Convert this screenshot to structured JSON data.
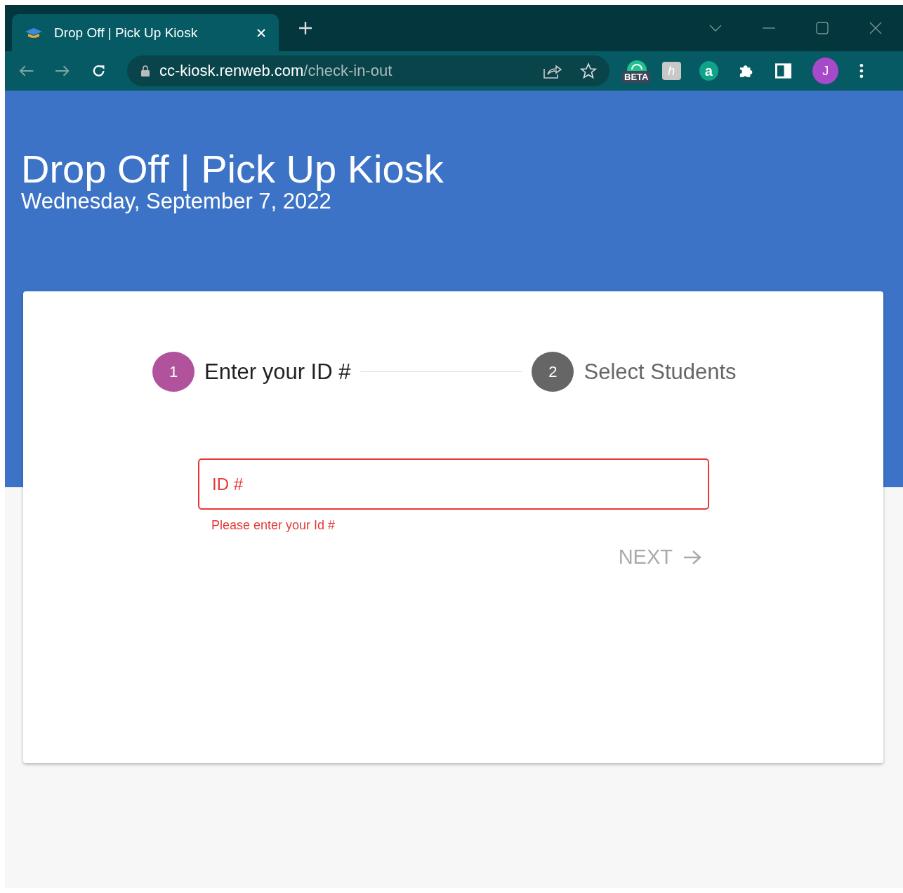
{
  "browser": {
    "tab_title": "Drop Off | Pick Up Kiosk",
    "url_host": "cc-kiosk.renweb.com",
    "url_path": "/check-in-out",
    "extension_badge": "BETA",
    "extension_letters": [
      "h",
      "a"
    ],
    "avatar": "J"
  },
  "header": {
    "title": "Drop Off | Pick Up Kiosk",
    "date": "Wednesday, September 7, 2022"
  },
  "steps": [
    {
      "number": "1",
      "label": "Enter your ID #",
      "selected": true
    },
    {
      "number": "2",
      "label": "Select Students",
      "selected": false
    }
  ],
  "id_field": {
    "placeholder": "ID #",
    "error": "Please enter your Id #"
  },
  "next_button": {
    "label": "NEXT",
    "disabled": true
  }
}
